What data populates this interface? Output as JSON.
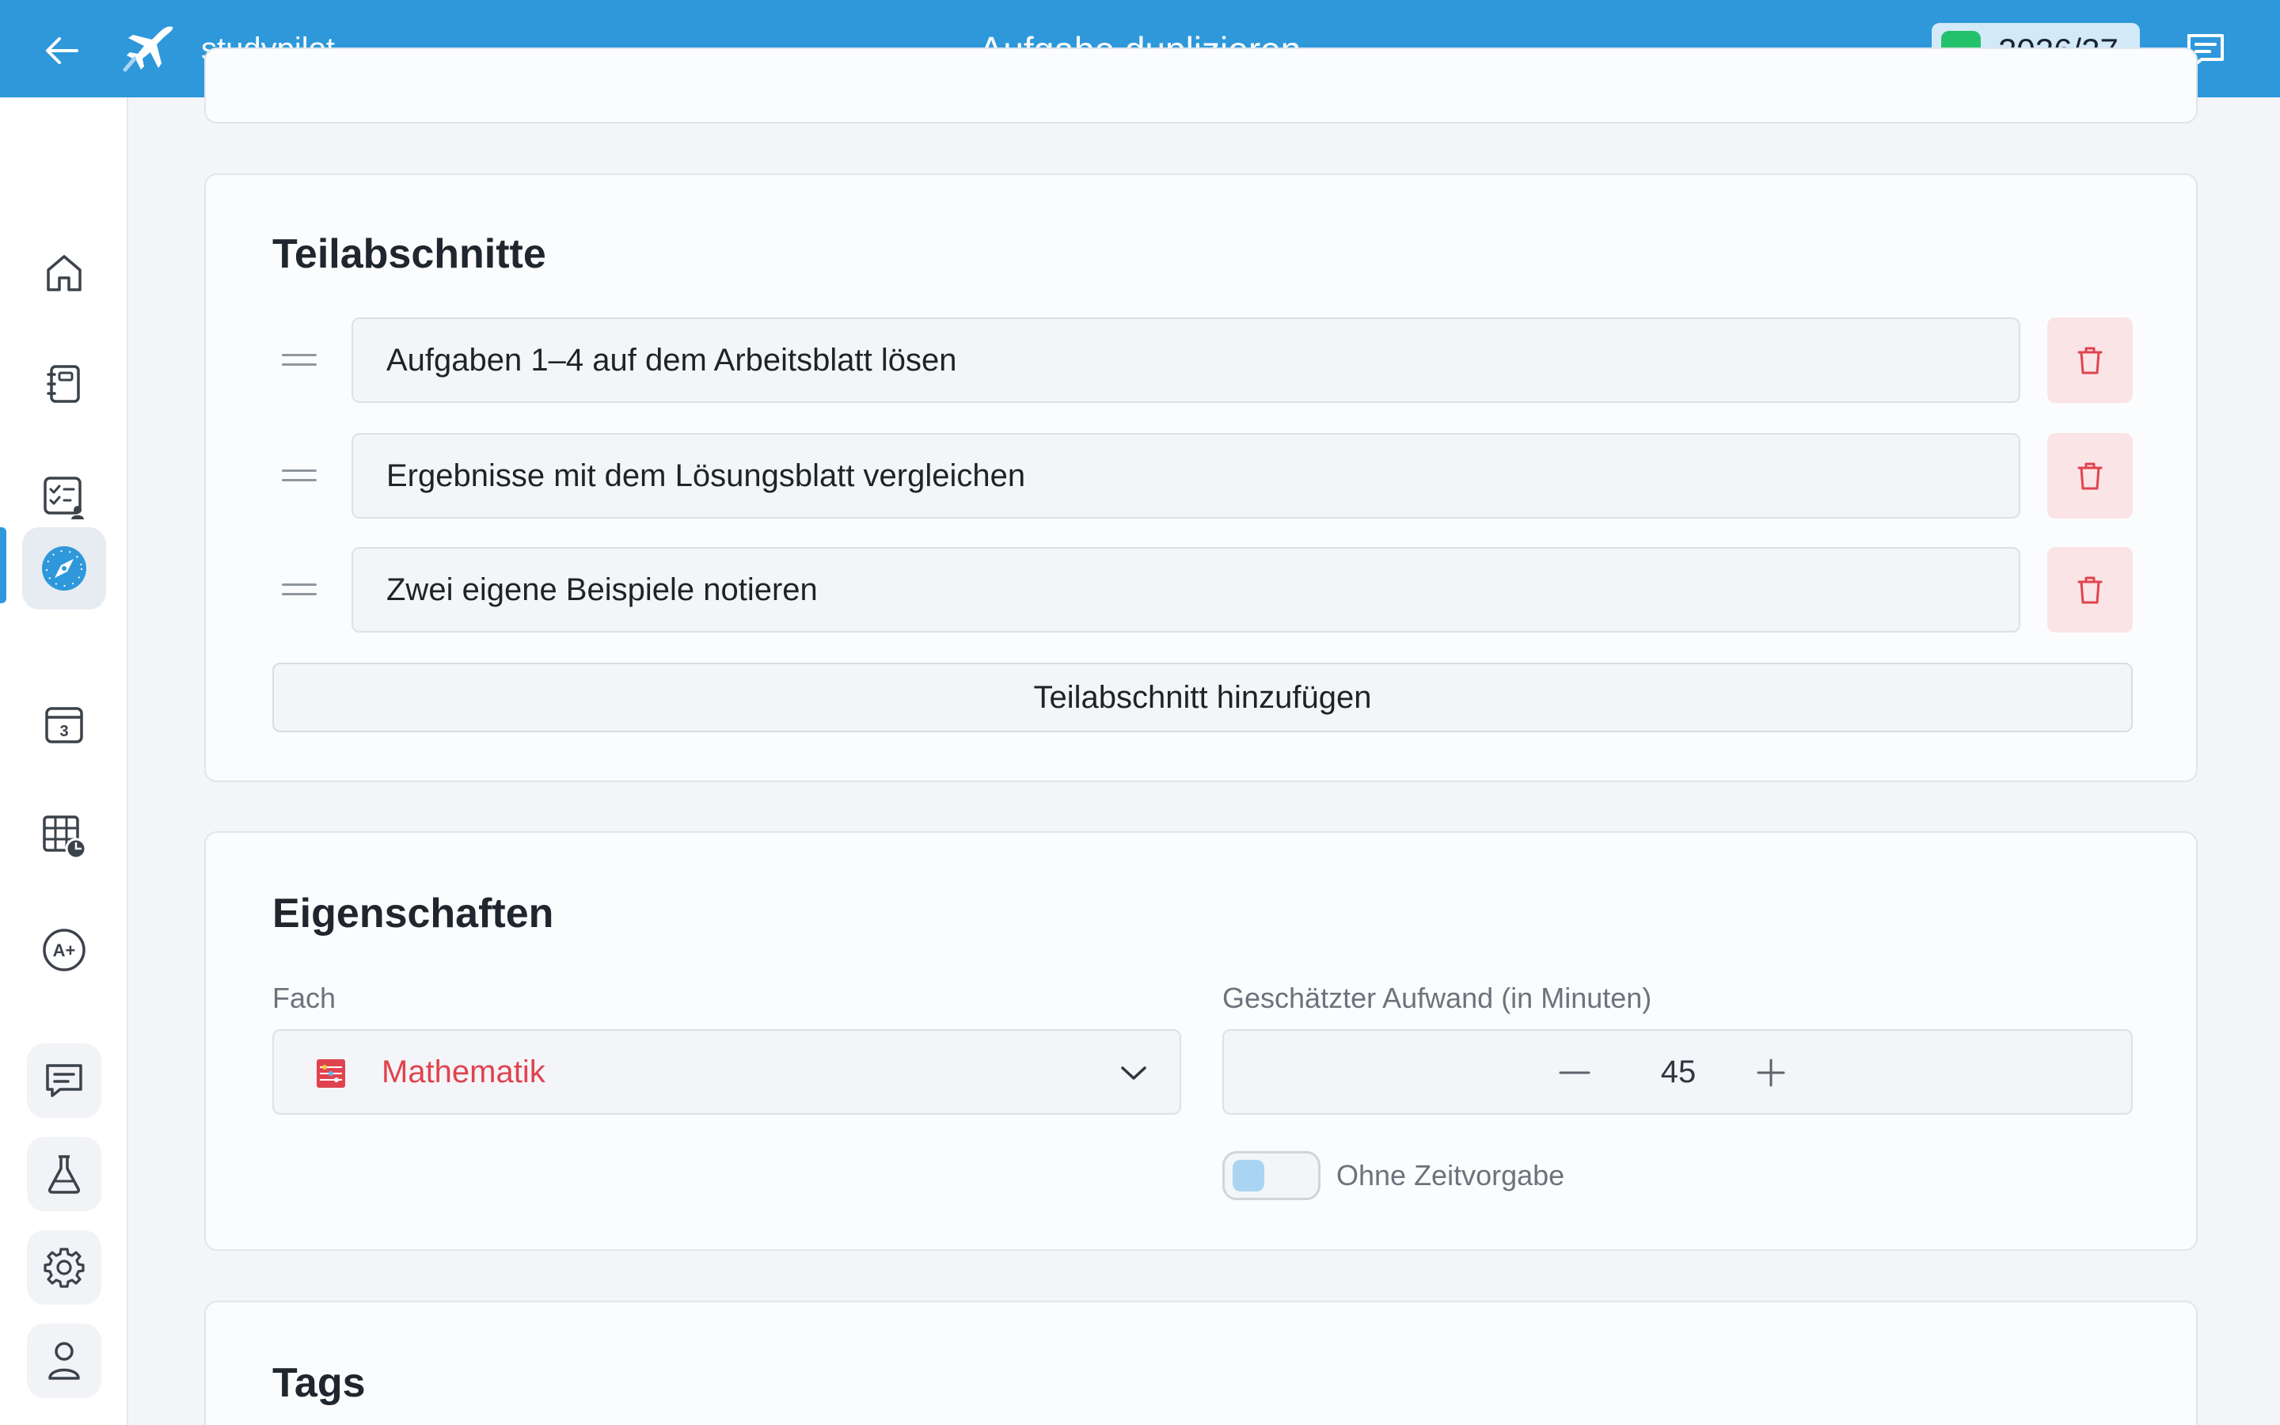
{
  "header": {
    "app_name": "studypilot",
    "page_title": "Aufgabe duplizieren",
    "school_year": "2026/27",
    "school_year_color": "#23c16b",
    "brand_color": "#2e98db"
  },
  "sidebar": {
    "items": [
      {
        "icon": "home-icon",
        "active": false
      },
      {
        "icon": "notebook-icon",
        "active": false
      },
      {
        "icon": "task-list-icon",
        "active": false
      },
      {
        "icon": "compass-icon",
        "active": true
      },
      {
        "icon": "calendar-icon",
        "active": false
      },
      {
        "icon": "timetable-icon",
        "active": false
      },
      {
        "icon": "grades-icon",
        "active": false
      }
    ],
    "calendar_day": "3",
    "grades_badge": "A+",
    "bottom_items": [
      "chat-icon",
      "flask-icon",
      "gear-icon",
      "user-icon"
    ]
  },
  "subsections": {
    "title": "Teilabschnitte",
    "items": [
      "Aufgaben 1–4 auf dem Arbeitsblatt lösen",
      "Ergebnisse mit dem Lösungsblatt vergleichen",
      "Zwei eigene Beispiele notieren"
    ],
    "add_label": "Teilabschnitt hinzufügen"
  },
  "properties": {
    "title": "Eigenschaften",
    "subject_label": "Fach",
    "subject_value": "Mathematik",
    "subject_color": "#e0434e",
    "effort_label": "Geschätzter Aufwand (in Minuten)",
    "effort_value": "45",
    "no_time_label": "Ohne Zeitvorgabe",
    "no_time_enabled": false
  },
  "tags": {
    "title": "Tags"
  }
}
